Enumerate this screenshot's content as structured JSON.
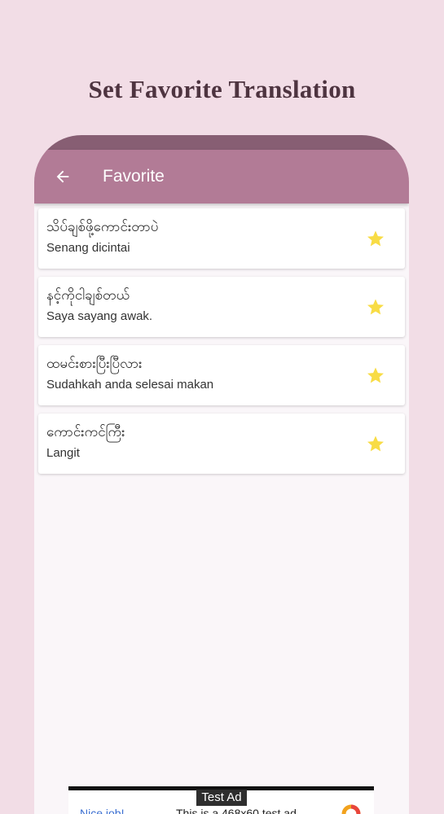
{
  "headline": "Set Favorite Translation",
  "appbar": {
    "title": "Favorite",
    "back_icon": "arrow-left-icon"
  },
  "colors": {
    "background": "#f2dde6",
    "appbar": "#b27b96",
    "appbar_top": "#875e73",
    "star": "#f8dc45",
    "headline": "#4e3440"
  },
  "favorites": [
    {
      "myanmar": "သိပ်ချစ်ဖို့ကောင်းတာပဲ",
      "malay": "Senang dicintai",
      "icon": "star-icon"
    },
    {
      "myanmar": "နင့်ကိုငါချစ်တယ်",
      "malay": "Saya sayang awak.",
      "icon": "star-icon"
    },
    {
      "myanmar": "ထမင်းစားပြီးပြီလား",
      "malay": "Sudahkah anda selesai makan",
      "icon": "star-icon"
    },
    {
      "myanmar": "ကောင်းကင်ကြီး",
      "malay": "Langit",
      "icon": "star-icon"
    }
  ],
  "ad": {
    "badge": "Test Ad",
    "left_text": "Nice job!",
    "main_text": "This is a 468x60 test ad",
    "logo_icon": "ad-network-logo-icon"
  }
}
